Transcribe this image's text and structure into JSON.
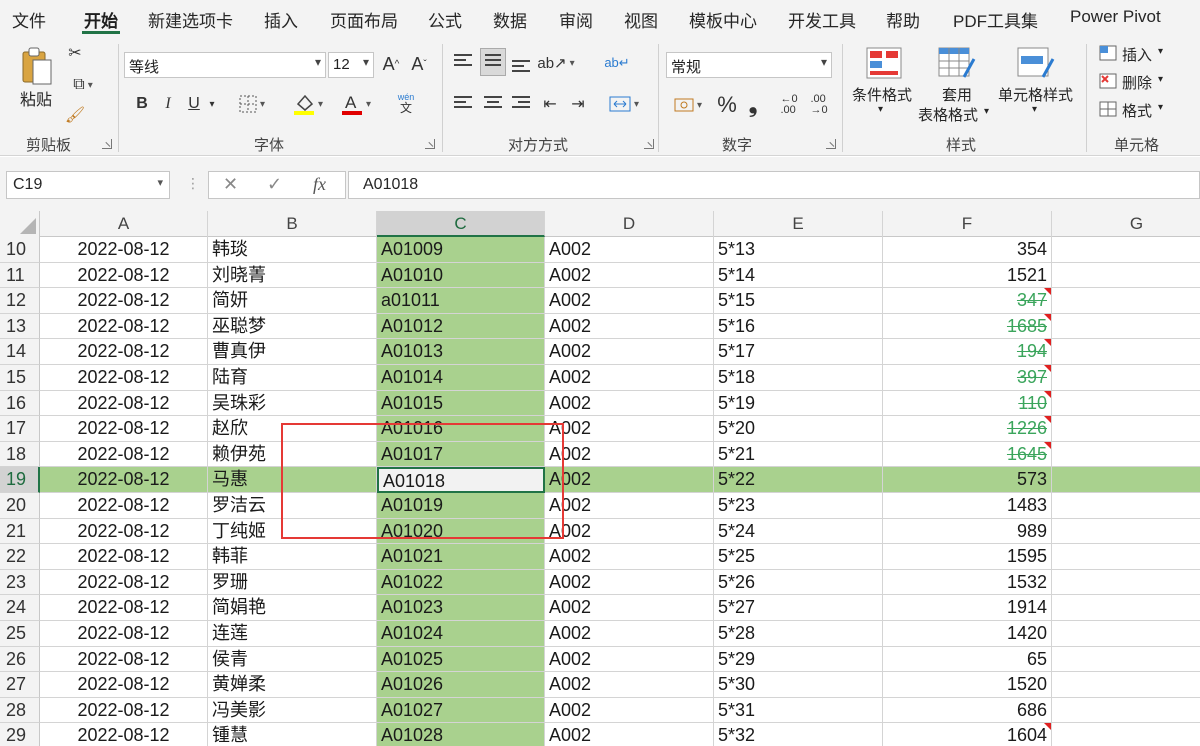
{
  "menu": {
    "tabs": [
      "文件",
      "开始",
      "新建选项卡",
      "插入",
      "页面布局",
      "公式",
      "数据",
      "审阅",
      "视图",
      "模板中心",
      "开发工具",
      "帮助",
      "PDF工具集",
      "Power Pivot"
    ],
    "active": "开始"
  },
  "ribbon": {
    "clipboard": {
      "label": "剪贴板",
      "paste": "粘贴"
    },
    "font": {
      "label": "字体",
      "name": "等线",
      "size": "12",
      "grow": "A^",
      "shrink": "Aˇ",
      "bold": "B",
      "italic": "I",
      "underline": "U",
      "wen": "wén",
      "wen_sub": "文",
      "fill_color": "#ffff00",
      "font_color": "#e00000"
    },
    "alignment": {
      "label": "对方方式"
    },
    "number": {
      "label": "数字",
      "format": "常规",
      "percent": "%",
      "comma": "❟"
    },
    "styles": {
      "label": "样式",
      "conditional": "条件格式",
      "table_line1": "套用",
      "table_line2": "表格格式",
      "cell_styles": "单元格样式"
    },
    "cells": {
      "label": "单元格",
      "insert": "插入",
      "delete": "删除",
      "format": "格式"
    }
  },
  "formula_bar": {
    "name_box": "C19",
    "formula": "A01018",
    "fx": "fx"
  },
  "grid": {
    "columns": [
      "A",
      "B",
      "C",
      "D",
      "E",
      "F",
      "G"
    ],
    "selected_column": "C",
    "active_row": 19,
    "rows": [
      {
        "n": "10",
        "a": "2022-08-12",
        "b": "韩琰",
        "c": "A01009",
        "d": "A002",
        "e": "5*13",
        "f": "354",
        "flag": false,
        "strike": false
      },
      {
        "n": "11",
        "a": "2022-08-12",
        "b": "刘晓菁",
        "c": "A01010",
        "d": "A002",
        "e": "5*14",
        "f": "1521",
        "flag": false,
        "strike": false
      },
      {
        "n": "12",
        "a": "2022-08-12",
        "b": "简妍",
        "c": "a01011",
        "d": "A002",
        "e": "5*15",
        "f": "347",
        "flag": true,
        "strike": true
      },
      {
        "n": "13",
        "a": "2022-08-12",
        "b": "巫聪梦",
        "c": "A01012",
        "d": "A002",
        "e": "5*16",
        "f": "1685",
        "flag": true,
        "strike": true
      },
      {
        "n": "14",
        "a": "2022-08-12",
        "b": "曹真伊",
        "c": "A01013",
        "d": "A002",
        "e": "5*17",
        "f": "194",
        "flag": true,
        "strike": true
      },
      {
        "n": "15",
        "a": "2022-08-12",
        "b": "陆育",
        "c": "A01014",
        "d": "A002",
        "e": "5*18",
        "f": "397",
        "flag": true,
        "strike": true
      },
      {
        "n": "16",
        "a": "2022-08-12",
        "b": "吴珠彩",
        "c": "A01015",
        "d": "A002",
        "e": "5*19",
        "f": "110",
        "flag": true,
        "strike": true
      },
      {
        "n": "17",
        "a": "2022-08-12",
        "b": "赵欣",
        "c": "A01016",
        "d": "A002",
        "e": "5*20",
        "f": "1226",
        "flag": true,
        "strike": true
      },
      {
        "n": "18",
        "a": "2022-08-12",
        "b": "赖伊苑",
        "c": "A01017",
        "d": "A002",
        "e": "5*21",
        "f": "1645",
        "flag": true,
        "strike": true
      },
      {
        "n": "19",
        "a": "2022-08-12",
        "b": "马惠",
        "c": "A01018",
        "d": "A002",
        "e": "5*22",
        "f": "573",
        "flag": false,
        "strike": false
      },
      {
        "n": "20",
        "a": "2022-08-12",
        "b": "罗洁云",
        "c": "A01019",
        "d": "A002",
        "e": "5*23",
        "f": "1483",
        "flag": false,
        "strike": false
      },
      {
        "n": "21",
        "a": "2022-08-12",
        "b": "丁纯姬",
        "c": "A01020",
        "d": "A002",
        "e": "5*24",
        "f": "989",
        "flag": false,
        "strike": false
      },
      {
        "n": "22",
        "a": "2022-08-12",
        "b": "韩菲",
        "c": "A01021",
        "d": "A002",
        "e": "5*25",
        "f": "1595",
        "flag": false,
        "strike": false
      },
      {
        "n": "23",
        "a": "2022-08-12",
        "b": "罗珊",
        "c": "A01022",
        "d": "A002",
        "e": "5*26",
        "f": "1532",
        "flag": false,
        "strike": false
      },
      {
        "n": "24",
        "a": "2022-08-12",
        "b": "简娟艳",
        "c": "A01023",
        "d": "A002",
        "e": "5*27",
        "f": "1914",
        "flag": false,
        "strike": false
      },
      {
        "n": "25",
        "a": "2022-08-12",
        "b": "连莲",
        "c": "A01024",
        "d": "A002",
        "e": "5*28",
        "f": "1420",
        "flag": false,
        "strike": false
      },
      {
        "n": "26",
        "a": "2022-08-12",
        "b": "侯青",
        "c": "A01025",
        "d": "A002",
        "e": "5*29",
        "f": "65",
        "flag": false,
        "strike": false
      },
      {
        "n": "27",
        "a": "2022-08-12",
        "b": "黄婵柔",
        "c": "A01026",
        "d": "A002",
        "e": "5*30",
        "f": "1520",
        "flag": false,
        "strike": false
      },
      {
        "n": "28",
        "a": "2022-08-12",
        "b": "冯美影",
        "c": "A01027",
        "d": "A002",
        "e": "5*31",
        "f": "686",
        "flag": false,
        "strike": false
      },
      {
        "n": "29",
        "a": "2022-08-12",
        "b": "锺慧",
        "c": "A01028",
        "d": "A002",
        "e": "5*32",
        "f": "1604",
        "flag": true,
        "strike": false
      }
    ]
  }
}
